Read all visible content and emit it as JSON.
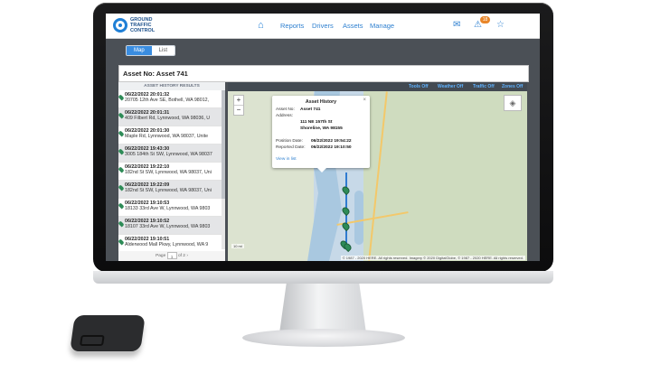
{
  "brand": {
    "name": "GROUND TRAFFIC CONTROL"
  },
  "nav": {
    "links": [
      "Reports",
      "Drivers",
      "Assets",
      "Manage"
    ],
    "alerts_count": "18"
  },
  "view_tabs": [
    "Map",
    "List"
  ],
  "page_title": "Asset No: Asset 741",
  "map_toggles": [
    "Tools Off",
    "Weather Off",
    "Traffic Off",
    "Zones Off"
  ],
  "history": {
    "header": "ASSET HISTORY RESULTS",
    "items": [
      {
        "date": "06/22/2022 20:01:32",
        "address": "20705 12th Ave SE, Bothell, WA 98012,"
      },
      {
        "date": "06/22/2022 20:01:31",
        "address": "409 Filbert Rd, Lynnwood, WA 98036, U"
      },
      {
        "date": "06/22/2022 20:01:30",
        "address": "Maple Rd, Lynnwood, WA 98037, Unite"
      },
      {
        "date": "06/22/2022 19:43:30",
        "address": "3005 184th St SW, Lynnwood, WA 98037"
      },
      {
        "date": "06/22/2022 19:22:10",
        "address": "182nd St SW, Lynnwood, WA 98037, Uni"
      },
      {
        "date": "06/22/2022 19:22:09",
        "address": "182nd St SW, Lynnwood, WA 98037, Uni"
      },
      {
        "date": "06/22/2022 19:10:53",
        "address": "18133 33rd Ave W, Lynnwood, WA 9803"
      },
      {
        "date": "06/22/2022 19:10:52",
        "address": "18107 33rd Ave W, Lynnwood, WA 9803"
      },
      {
        "date": "06/22/2022 19:10:51",
        "address": "Alderwood Mall Pkwy, Lynnwood, WA 9"
      }
    ],
    "pager": {
      "prefix": "Page",
      "page": "1",
      "suffix": "of 2"
    }
  },
  "popup": {
    "title": "Asset History",
    "asset_label": "Asset No:",
    "asset_value": "Asset 741",
    "address_label": "Address:",
    "address_line1": "111 NE 157th St",
    "address_line2": "Shoreline, WA 98155",
    "position_label": "Position Date:",
    "position_value": "06/22/2022 19:54:22",
    "reported_label": "Reported Date:",
    "reported_value": "06/22/2022 19:10:50",
    "link": "View in list"
  },
  "map": {
    "scale_label": "10 mi",
    "attribution": "© 1987 - 2020 HERE. All rights reserved. Imagery © 2020 DigitalGlobe, © 1987 - 2020 HERE. All rights reserved."
  }
}
